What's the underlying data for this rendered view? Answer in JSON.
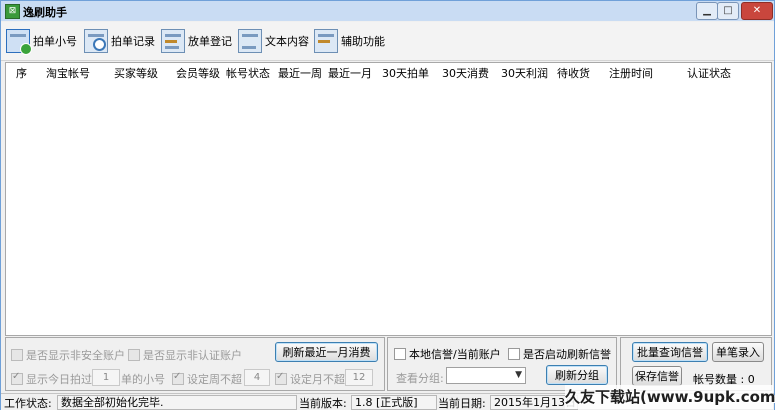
{
  "window": {
    "title": "逸刷助手",
    "controls": {
      "minimize": "▁",
      "maximize": "□",
      "close": "✕"
    }
  },
  "toolbar": {
    "items": [
      {
        "label": "拍单小号",
        "icon": "add-user-icon"
      },
      {
        "label": "拍单记录",
        "icon": "search-record-icon"
      },
      {
        "label": "放单登记",
        "icon": "register-icon"
      },
      {
        "label": "文本内容",
        "icon": "text-window-icon"
      },
      {
        "label": "辅助功能",
        "icon": "tools-icon"
      }
    ]
  },
  "table": {
    "columns": [
      "序",
      "淘宝帐号",
      "买家等级",
      "会员等级",
      "帐号状态",
      "最近一周",
      "最近一月",
      "30天拍单",
      "30天消费",
      "30天利润",
      "待收货",
      "注册时间",
      "认证状态"
    ],
    "rows": []
  },
  "filters": {
    "show_unsafe": "是否显示非安全账户",
    "show_unverified": "是否显示非认证账户",
    "refresh_month_button": "刷新最近一月消费",
    "show_today_prefix": "显示今日拍过",
    "show_today_value": "1",
    "show_today_suffix": "单的小号",
    "week_limit_label": "设定周不超",
    "week_limit_value": "4",
    "month_limit_label": "设定月不超",
    "month_limit_value": "12"
  },
  "group_panel": {
    "local_credit": "本地信誉/当前账户",
    "auto_refresh": "是否启动刷新信誉",
    "view_group_label": "查看分组:",
    "view_group_value": "",
    "refresh_group_button": "刷新分组"
  },
  "right_panel": {
    "batch_query_button": "批量查询信誉",
    "single_entry_button": "单笔录入",
    "save_credit_button": "保存信誉",
    "account_count_label": "帐号数量 : 0"
  },
  "statusbar": {
    "work_status_label": "工作状态:",
    "work_status_value": "数据全部初始化完毕.",
    "version_label": "当前版本:",
    "version_value": "1.8 [正式版]",
    "date_label": "当前日期:",
    "date_value": "2015年1月13日"
  },
  "watermark": "久友下载站(www.9upk.com)",
  "colors": {
    "accent": "#3c7fb1",
    "titlebar": "#c9dcf3",
    "close": "#c9463d"
  }
}
